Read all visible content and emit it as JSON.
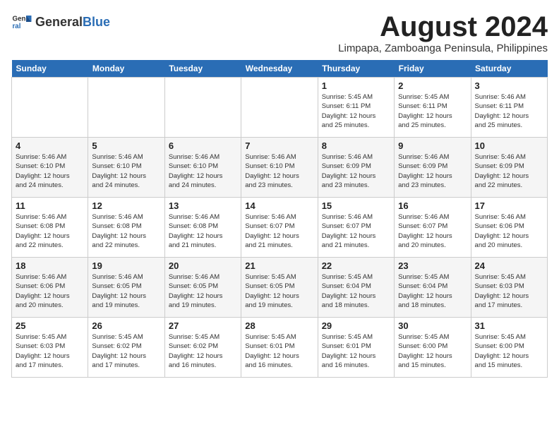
{
  "logo": {
    "text_general": "General",
    "text_blue": "Blue"
  },
  "calendar": {
    "title": "August 2024",
    "subtitle": "Limpapa, Zamboanga Peninsula, Philippines",
    "days_of_week": [
      "Sunday",
      "Monday",
      "Tuesday",
      "Wednesday",
      "Thursday",
      "Friday",
      "Saturday"
    ],
    "weeks": [
      [
        {
          "day": "",
          "info": ""
        },
        {
          "day": "",
          "info": ""
        },
        {
          "day": "",
          "info": ""
        },
        {
          "day": "",
          "info": ""
        },
        {
          "day": "1",
          "info": "Sunrise: 5:45 AM\nSunset: 6:11 PM\nDaylight: 12 hours\nand 25 minutes."
        },
        {
          "day": "2",
          "info": "Sunrise: 5:45 AM\nSunset: 6:11 PM\nDaylight: 12 hours\nand 25 minutes."
        },
        {
          "day": "3",
          "info": "Sunrise: 5:46 AM\nSunset: 6:11 PM\nDaylight: 12 hours\nand 25 minutes."
        }
      ],
      [
        {
          "day": "4",
          "info": "Sunrise: 5:46 AM\nSunset: 6:10 PM\nDaylight: 12 hours\nand 24 minutes."
        },
        {
          "day": "5",
          "info": "Sunrise: 5:46 AM\nSunset: 6:10 PM\nDaylight: 12 hours\nand 24 minutes."
        },
        {
          "day": "6",
          "info": "Sunrise: 5:46 AM\nSunset: 6:10 PM\nDaylight: 12 hours\nand 24 minutes."
        },
        {
          "day": "7",
          "info": "Sunrise: 5:46 AM\nSunset: 6:10 PM\nDaylight: 12 hours\nand 23 minutes."
        },
        {
          "day": "8",
          "info": "Sunrise: 5:46 AM\nSunset: 6:09 PM\nDaylight: 12 hours\nand 23 minutes."
        },
        {
          "day": "9",
          "info": "Sunrise: 5:46 AM\nSunset: 6:09 PM\nDaylight: 12 hours\nand 23 minutes."
        },
        {
          "day": "10",
          "info": "Sunrise: 5:46 AM\nSunset: 6:09 PM\nDaylight: 12 hours\nand 22 minutes."
        }
      ],
      [
        {
          "day": "11",
          "info": "Sunrise: 5:46 AM\nSunset: 6:08 PM\nDaylight: 12 hours\nand 22 minutes."
        },
        {
          "day": "12",
          "info": "Sunrise: 5:46 AM\nSunset: 6:08 PM\nDaylight: 12 hours\nand 22 minutes."
        },
        {
          "day": "13",
          "info": "Sunrise: 5:46 AM\nSunset: 6:08 PM\nDaylight: 12 hours\nand 21 minutes."
        },
        {
          "day": "14",
          "info": "Sunrise: 5:46 AM\nSunset: 6:07 PM\nDaylight: 12 hours\nand 21 minutes."
        },
        {
          "day": "15",
          "info": "Sunrise: 5:46 AM\nSunset: 6:07 PM\nDaylight: 12 hours\nand 21 minutes."
        },
        {
          "day": "16",
          "info": "Sunrise: 5:46 AM\nSunset: 6:07 PM\nDaylight: 12 hours\nand 20 minutes."
        },
        {
          "day": "17",
          "info": "Sunrise: 5:46 AM\nSunset: 6:06 PM\nDaylight: 12 hours\nand 20 minutes."
        }
      ],
      [
        {
          "day": "18",
          "info": "Sunrise: 5:46 AM\nSunset: 6:06 PM\nDaylight: 12 hours\nand 20 minutes."
        },
        {
          "day": "19",
          "info": "Sunrise: 5:46 AM\nSunset: 6:05 PM\nDaylight: 12 hours\nand 19 minutes."
        },
        {
          "day": "20",
          "info": "Sunrise: 5:46 AM\nSunset: 6:05 PM\nDaylight: 12 hours\nand 19 minutes."
        },
        {
          "day": "21",
          "info": "Sunrise: 5:45 AM\nSunset: 6:05 PM\nDaylight: 12 hours\nand 19 minutes."
        },
        {
          "day": "22",
          "info": "Sunrise: 5:45 AM\nSunset: 6:04 PM\nDaylight: 12 hours\nand 18 minutes."
        },
        {
          "day": "23",
          "info": "Sunrise: 5:45 AM\nSunset: 6:04 PM\nDaylight: 12 hours\nand 18 minutes."
        },
        {
          "day": "24",
          "info": "Sunrise: 5:45 AM\nSunset: 6:03 PM\nDaylight: 12 hours\nand 17 minutes."
        }
      ],
      [
        {
          "day": "25",
          "info": "Sunrise: 5:45 AM\nSunset: 6:03 PM\nDaylight: 12 hours\nand 17 minutes."
        },
        {
          "day": "26",
          "info": "Sunrise: 5:45 AM\nSunset: 6:02 PM\nDaylight: 12 hours\nand 17 minutes."
        },
        {
          "day": "27",
          "info": "Sunrise: 5:45 AM\nSunset: 6:02 PM\nDaylight: 12 hours\nand 16 minutes."
        },
        {
          "day": "28",
          "info": "Sunrise: 5:45 AM\nSunset: 6:01 PM\nDaylight: 12 hours\nand 16 minutes."
        },
        {
          "day": "29",
          "info": "Sunrise: 5:45 AM\nSunset: 6:01 PM\nDaylight: 12 hours\nand 16 minutes."
        },
        {
          "day": "30",
          "info": "Sunrise: 5:45 AM\nSunset: 6:00 PM\nDaylight: 12 hours\nand 15 minutes."
        },
        {
          "day": "31",
          "info": "Sunrise: 5:45 AM\nSunset: 6:00 PM\nDaylight: 12 hours\nand 15 minutes."
        }
      ]
    ]
  }
}
